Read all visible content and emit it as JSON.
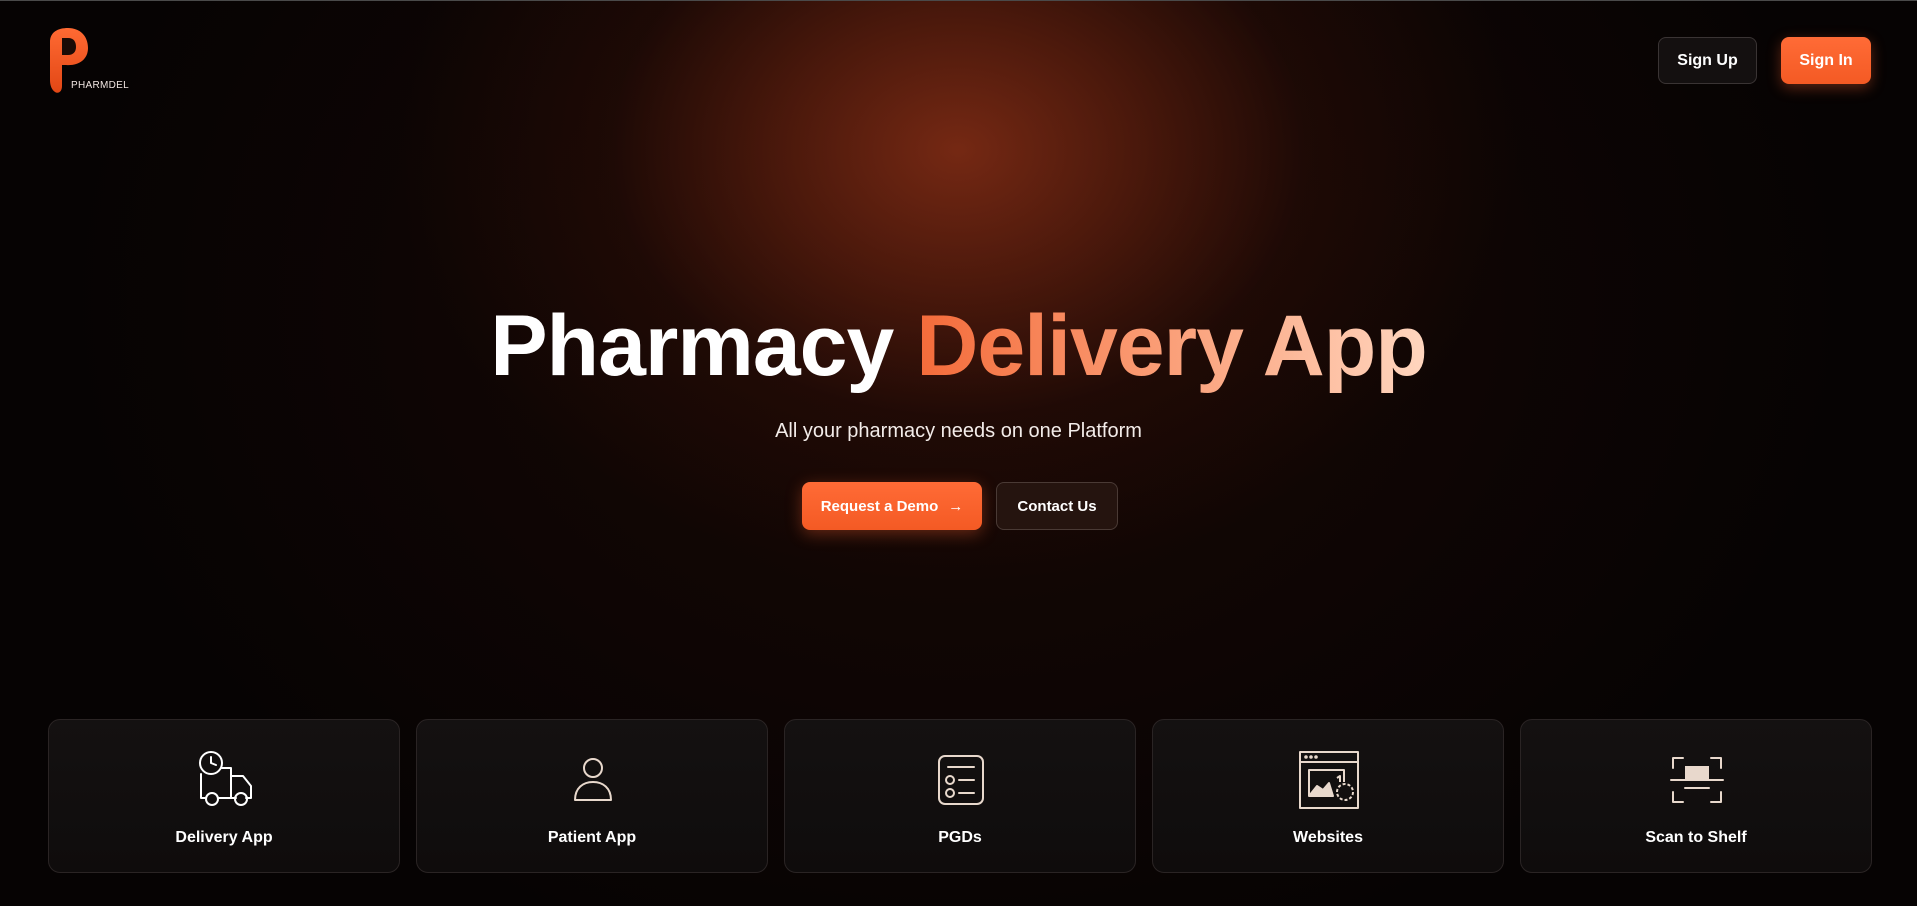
{
  "brand": {
    "name": "PHARMDEL",
    "accent": "#f45a24"
  },
  "header": {
    "signup_label": "Sign Up",
    "signin_label": "Sign In"
  },
  "hero": {
    "title_white": "Pharmacy",
    "title_accent": "Delivery App",
    "subtitle": "All your pharmacy needs on one Platform",
    "demo_label": "Request a Demo",
    "demo_icon": "arrow-right-icon",
    "contact_label": "Contact Us"
  },
  "features": [
    {
      "label": "Delivery App",
      "icon": "delivery-truck-icon"
    },
    {
      "label": "Patient App",
      "icon": "user-icon"
    },
    {
      "label": "PGDs",
      "icon": "checklist-icon"
    },
    {
      "label": "Websites",
      "icon": "website-icon"
    },
    {
      "label": "Scan to Shelf",
      "icon": "scan-icon"
    }
  ]
}
